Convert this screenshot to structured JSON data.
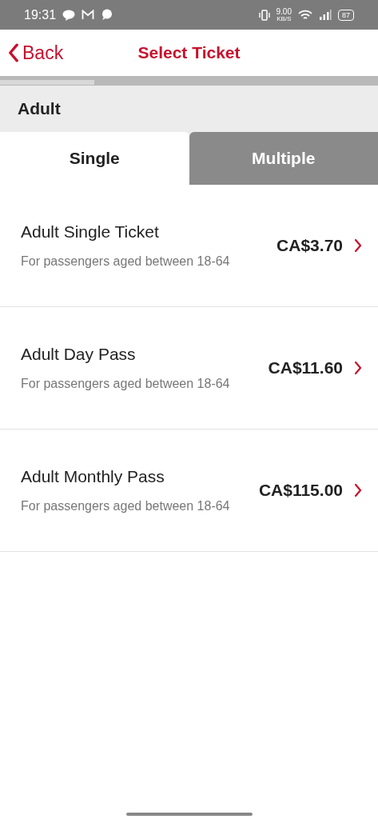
{
  "status_bar": {
    "time": "19:31",
    "speed": "9.00",
    "speed_unit": "KB/S",
    "battery": "87"
  },
  "header": {
    "back": "Back",
    "title": "Select Ticket"
  },
  "progress": {
    "level": 0.25
  },
  "section": "Adult",
  "tabs": [
    {
      "label": "Single",
      "selected": true
    },
    {
      "label": "Multiple",
      "selected": false
    }
  ],
  "tickets": [
    {
      "name": "Adult Single Ticket",
      "description": "For passengers aged between 18-64",
      "price": "CA$3.70"
    },
    {
      "name": "Adult Day Pass",
      "description": "For passengers aged between 18-64",
      "price": "CA$11.60"
    },
    {
      "name": "Adult Monthly Pass",
      "description": "For passengers aged between 18-64",
      "price": "CA$115.00"
    }
  ]
}
